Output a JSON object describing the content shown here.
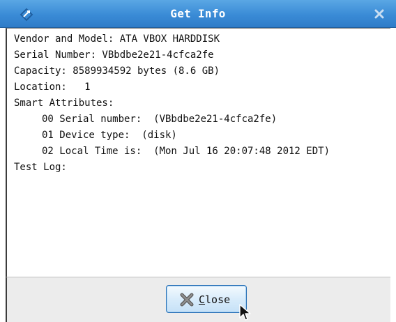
{
  "window": {
    "title": "Get Info"
  },
  "info_lines": [
    "Vendor and Model: ATA VBOX HARDDISK",
    "Serial Number: VBbdbe2e21-4cfca2fe",
    "Capacity: 8589934592 bytes (8.6 GB)",
    "Location:   1",
    "Smart Attributes:"
  ],
  "smart_attributes": [
    "00 Serial number:  (VBbdbe2e21-4cfca2fe)",
    "01 Device type:  (disk)",
    "02 Local Time is:  (Mon Jul 16 20:07:48 2012 EDT)"
  ],
  "test_log_label": "Test Log:",
  "buttons": {
    "close": {
      "mnemonic": "C",
      "rest": "lose"
    }
  },
  "icons": {
    "app": "diamond-arrow-icon",
    "titlebar_close": "close-x-icon",
    "button_close": "close-x-icon",
    "cursor": "mouse-pointer-icon"
  },
  "colors": {
    "titlebar": "#3a8bd6",
    "button_border": "#2a72b7",
    "button_fill": "#d9ecfb",
    "footer": "#ececec"
  }
}
